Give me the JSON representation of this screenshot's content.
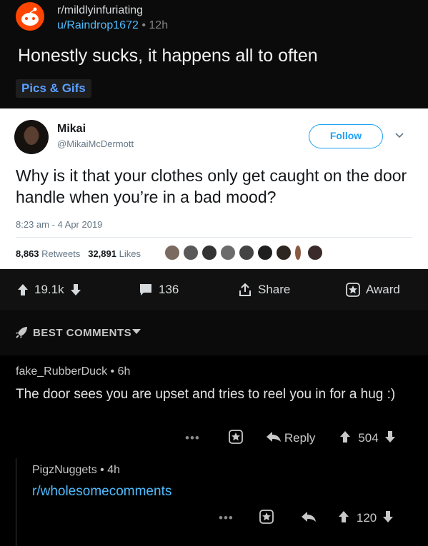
{
  "post": {
    "subreddit": "r/mildlyinfuriating",
    "author": "u/Raindrop1672",
    "separator": "•",
    "age": "12h",
    "title": "Honestly sucks, it happens all to often",
    "flair": "Pics & Gifs"
  },
  "tweet": {
    "name": "Mikai",
    "handle": "@MikaiMcDermott",
    "follow_label": "Follow",
    "text": "Why is it that your clothes only get caught on the door handle when you’re in a bad mood?",
    "timestamp": "8:23 am - 4 Apr 2019",
    "retweets_count": "8,863",
    "retweets_label": "Retweets",
    "likes_count": "32,891",
    "likes_label": "Likes"
  },
  "actions": {
    "upvotes": "19.1k",
    "comments": "136",
    "share_label": "Share",
    "award_label": "Award"
  },
  "sort": {
    "label": "BEST COMMENTS"
  },
  "comments": [
    {
      "author": "fake_RubberDuck",
      "age": "6h",
      "body": "The door sees you are upset and tries to reel you in for a hug :)",
      "reply_label": "Reply",
      "score": "504",
      "more": "•••"
    },
    {
      "author": "PigzNuggets",
      "age": "4h",
      "body": "r/wholesomecomments",
      "score": "120",
      "more": "•••"
    }
  ],
  "colors": {
    "accent_blue": "#4fbcff",
    "reddit_orange": "#ff4500",
    "twitter_blue": "#1da1f2"
  }
}
